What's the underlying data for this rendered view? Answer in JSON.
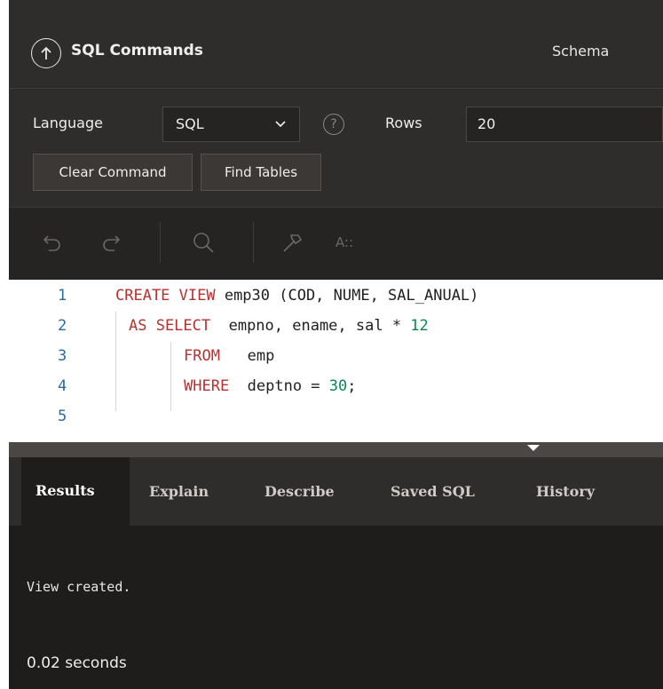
{
  "header": {
    "title": "SQL Commands",
    "schema_label": "Schema"
  },
  "toolbar": {
    "language_label": "Language",
    "language_value": "SQL",
    "rows_label": "Rows",
    "rows_value": "20",
    "clear_command_label": "Clear Command",
    "find_tables_label": "Find Tables"
  },
  "editor_toolbar": {
    "icons": [
      "undo-icon",
      "redo-icon",
      "search-icon",
      "hammer-icon",
      "autocomplete-icon"
    ],
    "autocomplete_glyph": "A::"
  },
  "editor": {
    "line_numbers": [
      "1",
      "2",
      "3",
      "4",
      "5"
    ],
    "lines": [
      {
        "kw": "CREATE VIEW",
        "rest": " emp30 (COD, NUME, SAL_ANUAL)"
      },
      {
        "kw": "AS SELECT",
        "rest": "  empno, ename, sal * ",
        "num": "12"
      },
      {
        "kw": "FROM",
        "rest": "   emp"
      },
      {
        "kw": "WHERE",
        "rest": "  deptno = ",
        "num": "30",
        "tail": ";"
      }
    ]
  },
  "results": {
    "tabs": [
      "Results",
      "Explain",
      "Describe",
      "Saved SQL",
      "History"
    ],
    "active_tab": "Results",
    "message": "View created.",
    "time": "0.02 seconds"
  },
  "colors": {
    "dark_bg": "#2f2d2b",
    "editor_keyword": "#b8312f",
    "editor_number": "#098658",
    "line_number": "#2b6a9e"
  }
}
